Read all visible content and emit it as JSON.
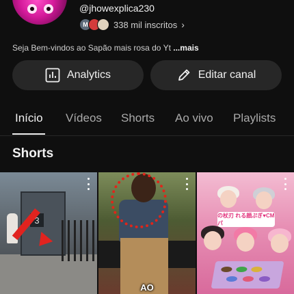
{
  "channel": {
    "handle": "@jhowexplica230",
    "subscribers": "338 mil inscritos",
    "subscriber_avatars": [
      "M",
      "",
      ""
    ],
    "description": "Seja Bem-vindos ao Sapão mais rosa do Yt",
    "more_label": "...mais",
    "avatar_color": "#d41a9a"
  },
  "actions": {
    "analytics_label": "Analytics",
    "analytics_icon": "bar-chart-icon",
    "edit_label": "Editar canal",
    "edit_icon": "pencil-icon"
  },
  "tabs": [
    {
      "label": "Início",
      "active": true
    },
    {
      "label": "Vídeos",
      "active": false
    },
    {
      "label": "Shorts",
      "active": false
    },
    {
      "label": "Ao vivo",
      "active": false
    },
    {
      "label": "Playlists",
      "active": false
    }
  ],
  "section": {
    "title": "Shorts"
  },
  "shorts": [
    {
      "caption": ""
    },
    {
      "caption": "AO"
    },
    {
      "caption": "",
      "sign_text": "の杖刃 れる顔ぷぎ♥CMパ"
    }
  ],
  "colors": {
    "background": "#0f0f0f",
    "button_bg": "#272727",
    "text_primary": "#f1f1f1",
    "text_secondary": "#aaaaaa"
  }
}
